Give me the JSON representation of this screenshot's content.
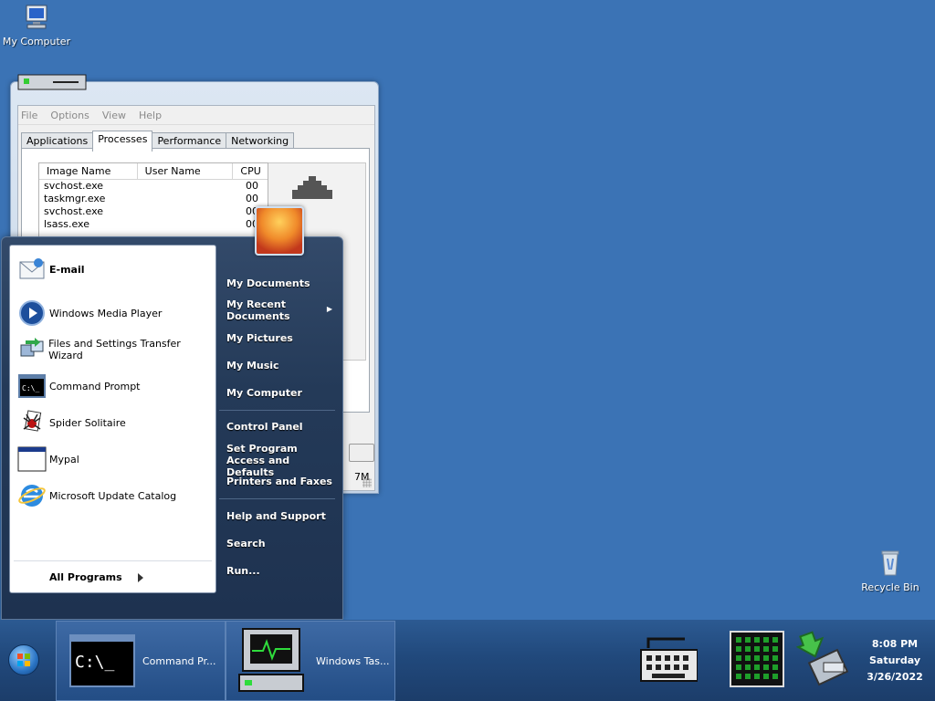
{
  "desktop": {
    "my_computer": "My Computer",
    "recycle_bin": "Recycle Bin"
  },
  "task_manager": {
    "menu": [
      "File",
      "Options",
      "View",
      "Help"
    ],
    "tabs": [
      "Applications",
      "Processes",
      "Performance",
      "Networking"
    ],
    "active_tab": "Processes",
    "columns": [
      "Image Name",
      "User Name",
      "CPU"
    ],
    "processes": [
      {
        "name": "svchost.exe",
        "cpu": "00"
      },
      {
        "name": "taskmgr.exe",
        "cpu": "00"
      },
      {
        "name": "svchost.exe",
        "cpu": "00"
      },
      {
        "name": "lsass.exe",
        "cpu": "00"
      }
    ],
    "status_fragment": "7M"
  },
  "start_menu": {
    "left_items": [
      {
        "label": "E-mail",
        "bold": true,
        "icon": "email-icon"
      },
      {
        "label": "Windows Media Player",
        "icon": "media-player-icon"
      },
      {
        "label": "Files and Settings Transfer Wizard",
        "icon": "transfer-wizard-icon"
      },
      {
        "label": "Command Prompt",
        "icon": "command-prompt-icon"
      },
      {
        "label": "Spider Solitaire",
        "icon": "spider-icon"
      },
      {
        "label": "Mypal",
        "icon": "window-icon"
      },
      {
        "label": "Microsoft Update Catalog",
        "icon": "ie-icon"
      }
    ],
    "all_programs": "All Programs",
    "right_items": [
      {
        "label": "My Documents"
      },
      {
        "label": "My Recent Documents",
        "submenu": true
      },
      {
        "label": "My Pictures"
      },
      {
        "label": "My Music"
      },
      {
        "label": "My Computer"
      },
      {
        "label": "Control Panel"
      },
      {
        "label": "Set Program Access and Defaults"
      },
      {
        "label": "Printers and Faxes"
      },
      {
        "label": "Help and Support"
      },
      {
        "label": "Search"
      },
      {
        "label": "Run..."
      }
    ]
  },
  "taskbar": {
    "buttons": [
      {
        "label": "Command Pr...",
        "icon": "command-prompt-icon"
      },
      {
        "label": "Windows Tas...",
        "icon": "task-manager-icon"
      }
    ],
    "tray_icons": [
      "keyboard-icon",
      "cpu-meter-icon",
      "network-icon"
    ],
    "clock": {
      "time": "8:08 PM",
      "day": "Saturday",
      "date": "3/26/2022"
    }
  },
  "colors": {
    "desktop": "#3b73b5",
    "start_menu_dark": "#243a58",
    "taskbar": "#21497c"
  }
}
